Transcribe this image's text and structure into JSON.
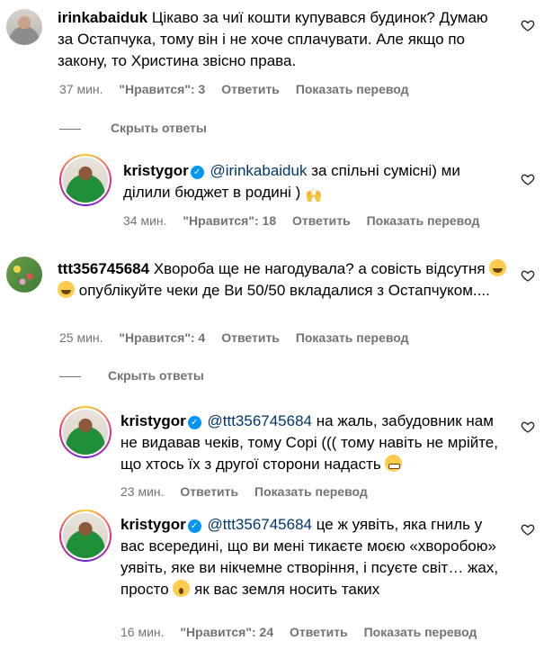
{
  "comments": [
    {
      "username": "irinkabaiduk",
      "text": "Цікаво за чиї кошти купувався будинок? Думаю за Остапчука, тому він і не хоче сплачувати. Але якщо по закону, то Христина звісно права.",
      "time": "37 мин.",
      "likes": "\"Нравится\": 3",
      "reply": "Ответить",
      "translate": "Показать перевод"
    },
    {
      "username": "ttt356745684",
      "text": "Хвороба ще не нагодувала? а совість відсутня",
      "text_after": "опублікуйте чеки де Ви 50/50 вкладалися з Остапчуком....",
      "time": "25 мин.",
      "likes": "\"Нравится\": 4",
      "reply": "Ответить",
      "translate": "Показать перевод"
    }
  ],
  "replies": [
    {
      "username": "kristygor",
      "mention": "@irinkabaiduk",
      "text": "за спільні сумісні) ми ділили бюджет в родині )",
      "time": "34 мин.",
      "likes": "\"Нравится\": 18",
      "reply": "Ответить",
      "translate": "Показать перевод"
    },
    {
      "username": "kristygor",
      "mention": "@ttt356745684",
      "text": "на жаль, забудовник нам не видавав чеків, тому Сорі ((( тому навіть не мрійте, що хтось їх з другої сторони надасть",
      "time": "23 мин.",
      "reply": "Ответить",
      "translate": "Показать перевод"
    },
    {
      "username": "kristygor",
      "mention": "@ttt356745684",
      "text": "це ж уявіть, яка гниль у вас всередині, що ви мені тикаєте моєю «хворобою» уявіть, яке ви нікчемне створіння, і псуєте світ… жах, просто",
      "text_after": "як вас земля носить таких",
      "time": "16 мин.",
      "likes": "\"Нравится\": 24",
      "reply": "Ответить",
      "translate": "Показать перевод"
    }
  ],
  "hide_replies_label": "Скрыть ответы",
  "verified_mark": "✓",
  "hands_emoji": "🙌",
  "icons": {
    "heart": "heart-outline-icon",
    "verified": "verified-badge-icon"
  },
  "colors": {
    "meta_text": "#737373",
    "mention": "#00376b",
    "verified": "#0095f6"
  }
}
